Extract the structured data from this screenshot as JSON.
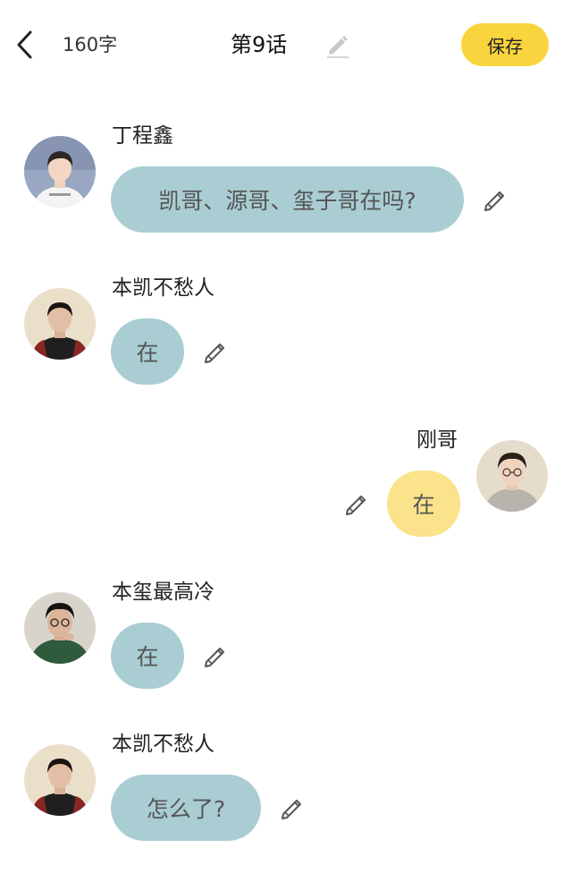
{
  "header": {
    "back_icon": "chevron-left-icon",
    "word_count": "160字",
    "title": "第9话",
    "title_edit_icon": "pencil-icon",
    "save_label": "保存",
    "save_color": "#FAD43E"
  },
  "messages": [
    {
      "side": "left",
      "name": "丁程鑫",
      "text": "凯哥、源哥、玺子哥在吗?",
      "bubble_color": "#A9CDD3",
      "edit_icon": "pencil-icon"
    },
    {
      "side": "left",
      "name": "本凯不愁人",
      "text": "在",
      "bubble_color": "#A9CDD3",
      "edit_icon": "pencil-icon"
    },
    {
      "side": "right",
      "name": "刚哥",
      "text": "在",
      "bubble_color": "#FBE38C",
      "edit_icon": "pencil-icon"
    },
    {
      "side": "left",
      "name": "本玺最高冷",
      "text": "在",
      "bubble_color": "#A9CDD3",
      "edit_icon": "pencil-icon"
    },
    {
      "side": "left",
      "name": "本凯不愁人",
      "text": "怎么了?",
      "bubble_color": "#A9CDD3",
      "edit_icon": "pencil-icon"
    }
  ]
}
